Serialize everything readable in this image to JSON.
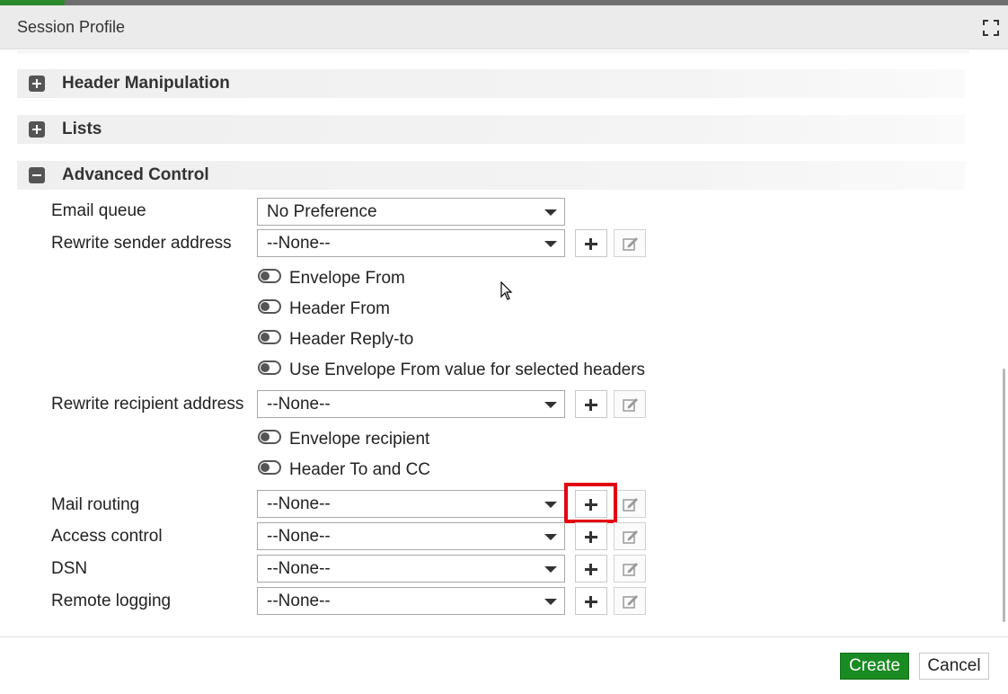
{
  "window": {
    "title": "Session Profile"
  },
  "sections": [
    {
      "label": "Header Manipulation",
      "state": "collapsed"
    },
    {
      "label": "Lists",
      "state": "collapsed"
    },
    {
      "label": "Advanced Control",
      "state": "expanded"
    }
  ],
  "fields": {
    "email_queue": {
      "label": "Email queue",
      "value": "No Preference"
    },
    "rewrite_sender": {
      "label": "Rewrite sender address",
      "value": "--None--"
    },
    "rewrite_recipient": {
      "label": "Rewrite recipient address",
      "value": "--None--"
    },
    "mail_routing": {
      "label": "Mail routing",
      "value": "--None--"
    },
    "access_control": {
      "label": "Access control",
      "value": "--None--"
    },
    "dsn": {
      "label": "DSN",
      "value": "--None--"
    },
    "remote_logging": {
      "label": "Remote logging",
      "value": "--None--"
    }
  },
  "toggles": {
    "envelope_from": {
      "label": "Envelope From",
      "on": false
    },
    "header_from": {
      "label": "Header From",
      "on": false
    },
    "header_reply_to": {
      "label": "Header Reply-to",
      "on": false
    },
    "use_envelope_from": {
      "label": "Use Envelope From value for selected headers",
      "on": false
    },
    "envelope_recipient": {
      "label": "Envelope recipient",
      "on": false
    },
    "header_to_cc": {
      "label": "Header To and CC",
      "on": false
    }
  },
  "footer": {
    "create_label": "Create",
    "cancel_label": "Cancel"
  },
  "colors": {
    "primary_button": "#1a8a23",
    "highlight": "#e3000f"
  },
  "icons": [
    "maximize-icon",
    "expand-plus-icon",
    "collapse-minus-icon",
    "dropdown-caret-icon",
    "add-icon",
    "edit-icon",
    "mouse-cursor-icon"
  ]
}
